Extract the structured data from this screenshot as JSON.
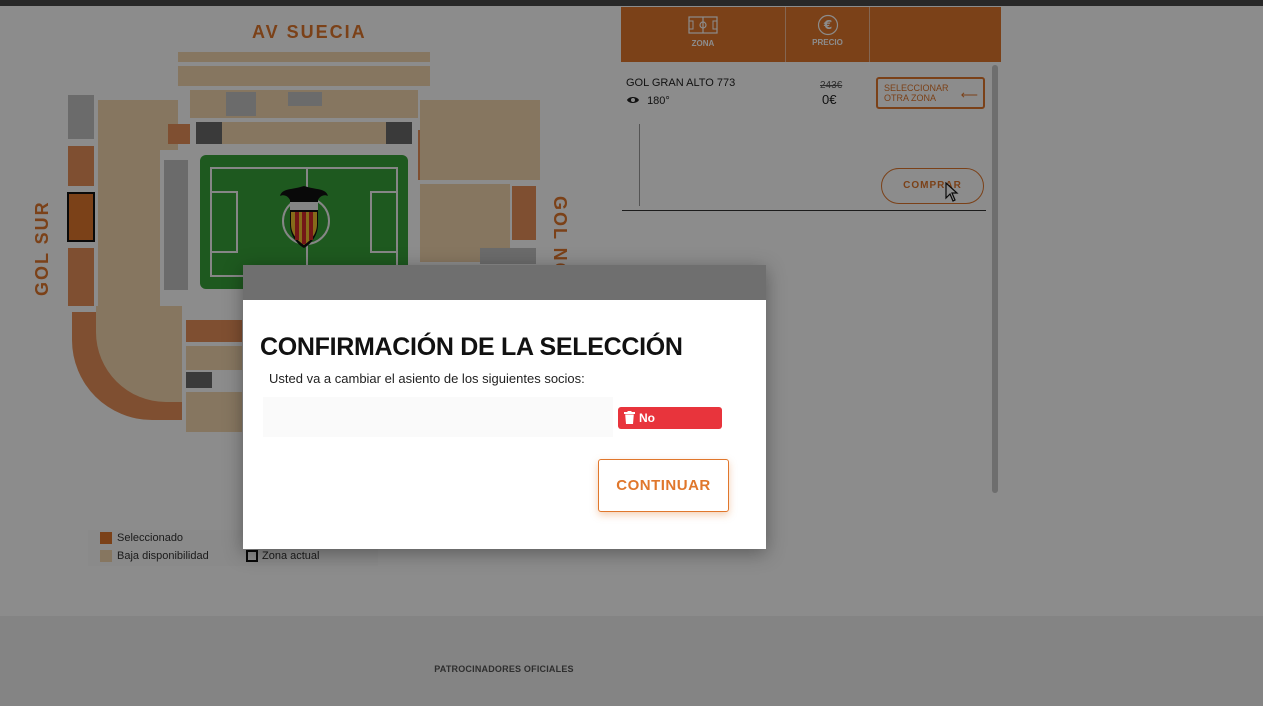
{
  "stadium": {
    "stand_top": "AV SUECIA",
    "stand_left": "GOL SUR",
    "stand_right": "GOL NO"
  },
  "legend": {
    "selected": "Seleccionado",
    "low_availability": "Baja disponibilidad",
    "current_zone": "Zona actual"
  },
  "panel": {
    "col_zone": "ZONA",
    "col_price": "PRECIO",
    "zone_name": "GOL GRAN ALTO 773",
    "view_label": "180°",
    "old_price": "243€",
    "new_price": "0€",
    "select_other_zone_line1": "SELECCIONAR",
    "select_other_zone_line2": "OTRA ZONA",
    "buy_label": "COMPRAR"
  },
  "modal": {
    "title": "CONFIRMACIÓN DE LA SELECCIÓN",
    "message": "Usted va a cambiar el asiento de los siguientes socios:",
    "no_select_label": "No seleccionar",
    "continue_label": "CONTINUAR"
  },
  "footer": {
    "sponsors_label": "PATROCINADORES OFICIALES"
  },
  "colors": {
    "accent": "#e0772c",
    "danger": "#e8343c",
    "pitch": "#37a33a"
  }
}
